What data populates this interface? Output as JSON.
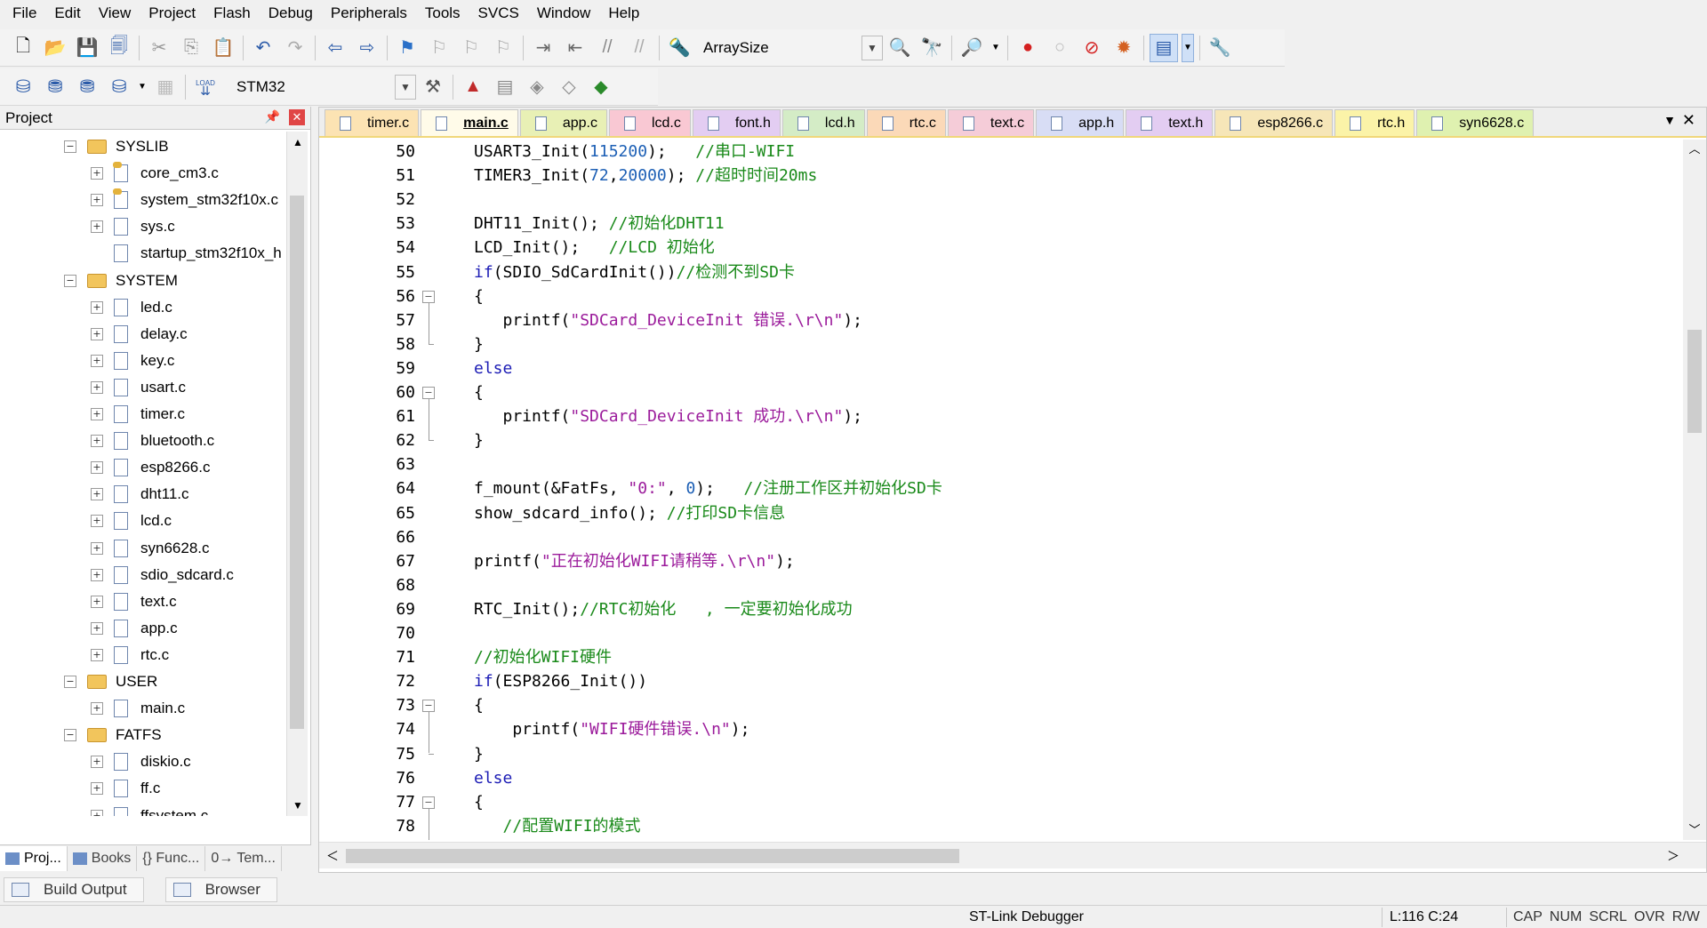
{
  "menu": [
    "File",
    "Edit",
    "View",
    "Project",
    "Flash",
    "Debug",
    "Peripherals",
    "Tools",
    "SVCS",
    "Window",
    "Help"
  ],
  "toolbar": {
    "find_combo_value": "ArraySize",
    "target_combo_value": "STM32",
    "load_label": "LOAD"
  },
  "project_panel": {
    "title": "Project",
    "tree": [
      {
        "label": "SYSLIB",
        "type": "folder",
        "level": 0,
        "expander": "⊟"
      },
      {
        "label": "core_cm3.c",
        "type": "file-keyed",
        "level": 1,
        "expander": "⊞"
      },
      {
        "label": "system_stm32f10x.c",
        "type": "file-keyed",
        "level": 1,
        "expander": "⊞"
      },
      {
        "label": "sys.c",
        "type": "file",
        "level": 1,
        "expander": "⊞"
      },
      {
        "label": "startup_stm32f10x_h",
        "type": "file",
        "level": 1,
        "expander": ""
      },
      {
        "label": "SYSTEM",
        "type": "folder",
        "level": 0,
        "expander": "⊟"
      },
      {
        "label": "led.c",
        "type": "file",
        "level": 1,
        "expander": "⊞"
      },
      {
        "label": "delay.c",
        "type": "file",
        "level": 1,
        "expander": "⊞"
      },
      {
        "label": "key.c",
        "type": "file",
        "level": 1,
        "expander": "⊞"
      },
      {
        "label": "usart.c",
        "type": "file",
        "level": 1,
        "expander": "⊞"
      },
      {
        "label": "timer.c",
        "type": "file",
        "level": 1,
        "expander": "⊞"
      },
      {
        "label": "bluetooth.c",
        "type": "file",
        "level": 1,
        "expander": "⊞"
      },
      {
        "label": "esp8266.c",
        "type": "file",
        "level": 1,
        "expander": "⊞"
      },
      {
        "label": "dht11.c",
        "type": "file",
        "level": 1,
        "expander": "⊞"
      },
      {
        "label": "lcd.c",
        "type": "file",
        "level": 1,
        "expander": "⊞"
      },
      {
        "label": "syn6628.c",
        "type": "file",
        "level": 1,
        "expander": "⊞"
      },
      {
        "label": "sdio_sdcard.c",
        "type": "file",
        "level": 1,
        "expander": "⊞"
      },
      {
        "label": "text.c",
        "type": "file",
        "level": 1,
        "expander": "⊞"
      },
      {
        "label": "app.c",
        "type": "file",
        "level": 1,
        "expander": "⊞"
      },
      {
        "label": "rtc.c",
        "type": "file",
        "level": 1,
        "expander": "⊞"
      },
      {
        "label": "USER",
        "type": "folder",
        "level": 0,
        "expander": "⊟"
      },
      {
        "label": "main.c",
        "type": "file",
        "level": 1,
        "expander": "⊞"
      },
      {
        "label": "FATFS",
        "type": "folder",
        "level": 0,
        "expander": "⊟"
      },
      {
        "label": "diskio.c",
        "type": "file",
        "level": 1,
        "expander": "⊞"
      },
      {
        "label": "ff.c",
        "type": "file",
        "level": 1,
        "expander": "⊞"
      },
      {
        "label": "ffsystem.c",
        "type": "file",
        "level": 1,
        "expander": "⊞"
      }
    ],
    "bottom_tabs": [
      "Proj...",
      "Books",
      "{} Func...",
      "0→ Tem..."
    ]
  },
  "editor": {
    "tabs": [
      {
        "label": "timer.c",
        "color": "#fce3b3",
        "active": false
      },
      {
        "label": "main.c",
        "color": "#fffbe9",
        "active": true
      },
      {
        "label": "app.c",
        "color": "#e8f0b5",
        "active": false
      },
      {
        "label": "lcd.c",
        "color": "#f9c8d3",
        "active": false
      },
      {
        "label": "font.h",
        "color": "#e3cdf2",
        "active": false
      },
      {
        "label": "lcd.h",
        "color": "#d4ecc6",
        "active": false
      },
      {
        "label": "rtc.c",
        "color": "#fbd9b8",
        "active": false
      },
      {
        "label": "text.c",
        "color": "#f5ccd8",
        "active": false
      },
      {
        "label": "app.h",
        "color": "#d8ddf5",
        "active": false
      },
      {
        "label": "text.h",
        "color": "#e3cdf2",
        "active": false
      },
      {
        "label": "esp8266.c",
        "color": "#f6e6b8",
        "active": false
      },
      {
        "label": "rtc.h",
        "color": "#fbf3a8",
        "active": false
      },
      {
        "label": "syn6628.c",
        "color": "#dff1b0",
        "active": false
      }
    ],
    "lines": [
      {
        "n": "50",
        "fold": "",
        "tokens": [
          [
            "",
            "USART3_Init("
          ],
          [
            "nm",
            "115200"
          ],
          [
            "",
            ");   "
          ],
          [
            "cm",
            "//串口-WIFI"
          ]
        ]
      },
      {
        "n": "51",
        "fold": "",
        "tokens": [
          [
            "",
            "TIMER3_Init("
          ],
          [
            "nm",
            "72"
          ],
          [
            "",
            ","
          ],
          [
            "nm",
            "20000"
          ],
          [
            "",
            "); "
          ],
          [
            "cm",
            "//超时时间20ms"
          ]
        ]
      },
      {
        "n": "52",
        "fold": "",
        "tokens": []
      },
      {
        "n": "53",
        "fold": "",
        "tokens": [
          [
            "",
            "DHT11_Init(); "
          ],
          [
            "cm",
            "//初始化DHT11"
          ]
        ]
      },
      {
        "n": "54",
        "fold": "",
        "tokens": [
          [
            "",
            "LCD_Init();   "
          ],
          [
            "cm",
            "//LCD 初始化"
          ]
        ]
      },
      {
        "n": "55",
        "fold": "",
        "tokens": [
          [
            "kw",
            "if"
          ],
          [
            "",
            "(SDIO_SdCardInit())"
          ],
          [
            "cm",
            "//检测不到SD卡"
          ]
        ]
      },
      {
        "n": "56",
        "fold": "⊟",
        "tokens": [
          [
            "",
            "{"
          ]
        ]
      },
      {
        "n": "57",
        "fold": "",
        "tokens": [
          [
            "",
            "   printf("
          ],
          [
            "st",
            "\"SDCard_DeviceInit 错误.\\r\\n\""
          ],
          [
            "",
            ");"
          ]
        ]
      },
      {
        "n": "58",
        "fold": "",
        "tokens": [
          [
            "",
            "}"
          ]
        ]
      },
      {
        "n": "59",
        "fold": "",
        "tokens": [
          [
            "kw",
            "else"
          ]
        ]
      },
      {
        "n": "60",
        "fold": "⊟",
        "tokens": [
          [
            "",
            "{"
          ]
        ]
      },
      {
        "n": "61",
        "fold": "",
        "tokens": [
          [
            "",
            "   printf("
          ],
          [
            "st",
            "\"SDCard_DeviceInit 成功.\\r\\n\""
          ],
          [
            "",
            ");"
          ]
        ]
      },
      {
        "n": "62",
        "fold": "",
        "tokens": [
          [
            "",
            "}"
          ]
        ]
      },
      {
        "n": "63",
        "fold": "",
        "tokens": []
      },
      {
        "n": "64",
        "fold": "",
        "tokens": [
          [
            "",
            "f_mount(&FatFs, "
          ],
          [
            "st",
            "\"0:\""
          ],
          [
            "",
            ", "
          ],
          [
            "nm",
            "0"
          ],
          [
            "",
            ");   "
          ],
          [
            "cm",
            "//注册工作区并初始化SD卡"
          ]
        ]
      },
      {
        "n": "65",
        "fold": "",
        "tokens": [
          [
            "",
            "show_sdcard_info(); "
          ],
          [
            "cm",
            "//打印SD卡信息"
          ]
        ]
      },
      {
        "n": "66",
        "fold": "",
        "tokens": []
      },
      {
        "n": "67",
        "fold": "",
        "tokens": [
          [
            "",
            "printf("
          ],
          [
            "st",
            "\"正在初始化WIFI请稍等.\\r\\n\""
          ],
          [
            "",
            ");"
          ]
        ]
      },
      {
        "n": "68",
        "fold": "",
        "tokens": []
      },
      {
        "n": "69",
        "fold": "",
        "tokens": [
          [
            "",
            "RTC_Init();"
          ],
          [
            "cm",
            "//RTC初始化   , 一定要初始化成功"
          ]
        ]
      },
      {
        "n": "70",
        "fold": "",
        "tokens": []
      },
      {
        "n": "71",
        "fold": "",
        "tokens": [
          [
            "cm",
            "//初始化WIFI硬件"
          ]
        ]
      },
      {
        "n": "72",
        "fold": "",
        "tokens": [
          [
            "kw",
            "if"
          ],
          [
            "",
            "(ESP8266_Init())"
          ]
        ]
      },
      {
        "n": "73",
        "fold": "⊟",
        "tokens": [
          [
            "",
            "{"
          ]
        ]
      },
      {
        "n": "74",
        "fold": "",
        "tokens": [
          [
            "",
            "    printf("
          ],
          [
            "st",
            "\"WIFI硬件错误.\\n\""
          ],
          [
            "",
            ");"
          ]
        ]
      },
      {
        "n": "75",
        "fold": "",
        "tokens": [
          [
            "",
            "}"
          ]
        ]
      },
      {
        "n": "76",
        "fold": "",
        "tokens": [
          [
            "kw",
            "else"
          ]
        ]
      },
      {
        "n": "77",
        "fold": "⊟",
        "tokens": [
          [
            "",
            "{"
          ]
        ]
      },
      {
        "n": "78",
        "fold": "",
        "tokens": [
          [
            "",
            "   "
          ],
          [
            "cm",
            "//配置WIFI的模式"
          ]
        ]
      }
    ]
  },
  "output_tabs": [
    "Build Output",
    "Browser"
  ],
  "status": {
    "debugger": "ST-Link Debugger",
    "position": "L:116 C:24",
    "flags": [
      "CAP",
      "NUM",
      "SCRL",
      "OVR",
      "R/W"
    ]
  }
}
